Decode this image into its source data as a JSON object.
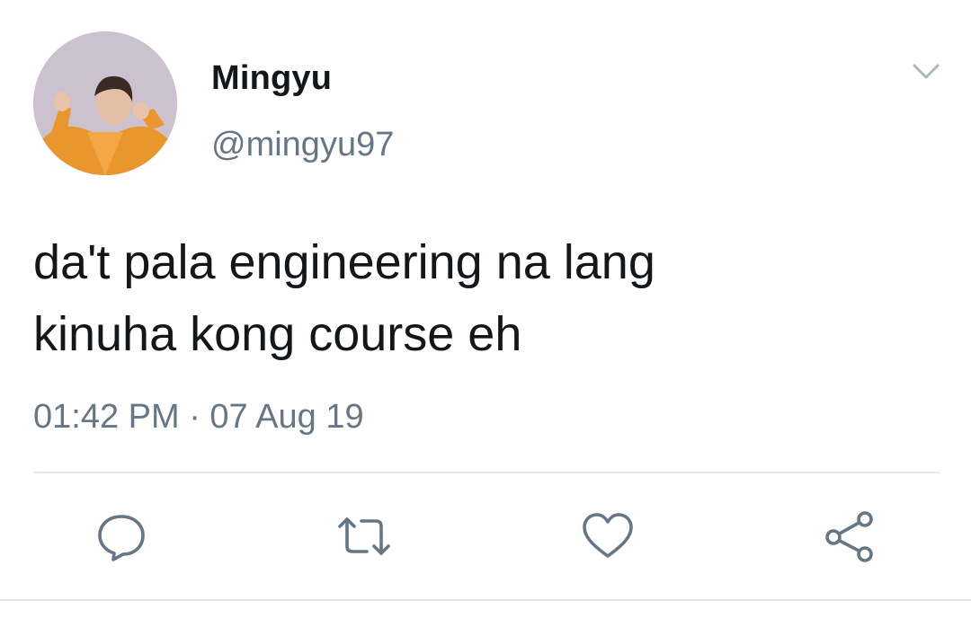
{
  "tweet": {
    "author": {
      "display_name": "Mingyu",
      "handle": "@mingyu97"
    },
    "text": "da't pala engineering na lang\nkinuha kong course eh",
    "timestamp": "01:42 PM · 07 Aug 19"
  },
  "icons": {
    "menu": "chevron-down-icon",
    "reply": "reply-icon",
    "retweet": "retweet-icon",
    "like": "heart-icon",
    "share": "share-icon"
  },
  "colors": {
    "text_primary": "#14171a",
    "text_secondary": "#657786",
    "icon": "#657786",
    "divider": "#e1e8ed"
  }
}
